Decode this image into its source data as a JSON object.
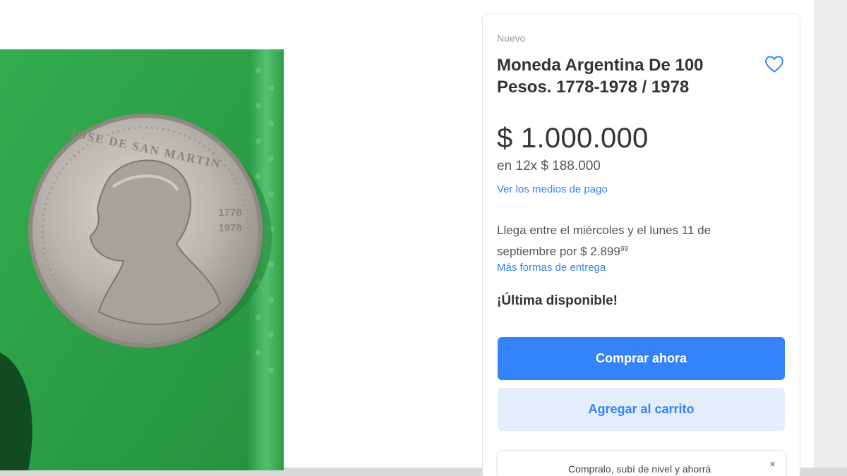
{
  "product": {
    "condition": "Nuevo",
    "title": "Moneda Argentina De 100 Pesos. 1778-1978 / 1978",
    "price": "$ 1.000.000",
    "installments": "en 12x $ 188.000",
    "payment_link": "Ver los medios de pago",
    "shipping_text": "Llega entre el miércoles y el lunes 11 de septiembre por $ 2.899",
    "shipping_cents": "99",
    "delivery_link": "Más formas de entrega",
    "stock": "¡Última disponible!"
  },
  "actions": {
    "buy_label": "Comprar ahora",
    "cart_label": "Agregar al carrito"
  },
  "promo": {
    "text": "Compralo, subí de nivel y ahorrá",
    "close": "×"
  },
  "photo": {
    "coin_legend": "JOSE DE SAN MARTIN",
    "coin_date_top": "1778",
    "coin_date_bottom": "1978"
  },
  "icons": {
    "favorite": "heart-icon",
    "close": "close-icon"
  },
  "colors": {
    "accent": "#3483fa",
    "accent_light": "#e3edfb",
    "photo_background": "#2ea64a"
  }
}
